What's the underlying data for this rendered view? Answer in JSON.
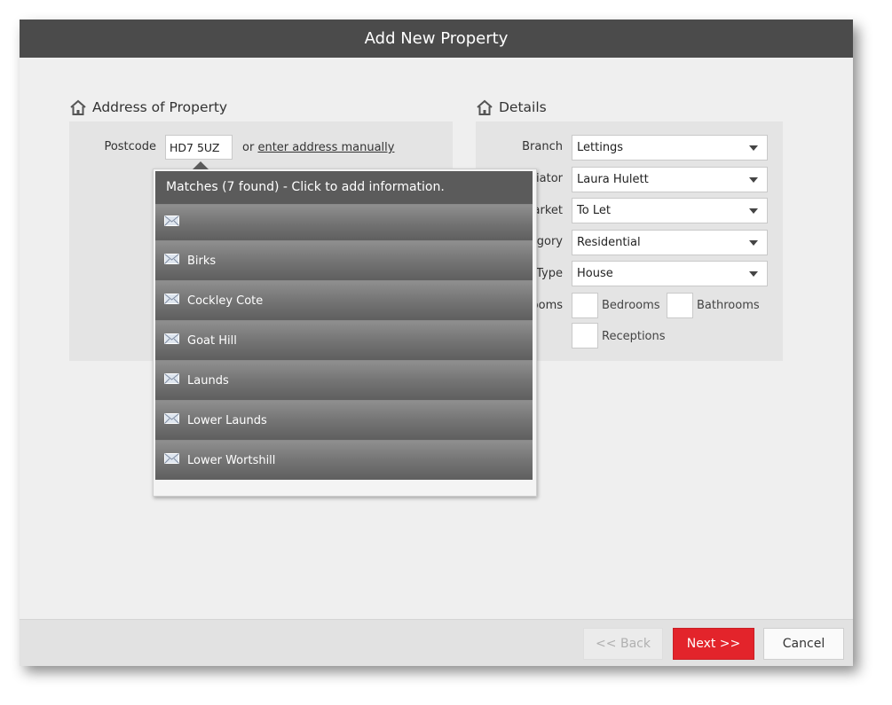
{
  "dialog": {
    "title": "Add New Property"
  },
  "address": {
    "section_title": "Address of Property",
    "postcode_label": "Postcode",
    "postcode_value": "HD7 5UZ",
    "or_text": "or",
    "manual_link": "enter address manually"
  },
  "details": {
    "section_title": "Details",
    "branch_label": "Branch",
    "branch_value": "Lettings",
    "negotiator_label_visible": "tiator",
    "negotiator_value": "Laura Hulett",
    "market_label_visible": "arket",
    "market_value": "To Let",
    "category_label_visible": "egory",
    "category_value": "Residential",
    "type_label_visible": "Type",
    "type_value": "House",
    "rooms_label_visible": "ooms",
    "bedrooms_label": "Bedrooms",
    "bathrooms_label": "Bathrooms",
    "receptions_label": "Receptions"
  },
  "matches": {
    "header": "Matches (7 found) - Click to add information.",
    "items": [
      "",
      "Birks",
      "Cockley Cote",
      "Goat Hill",
      "Launds",
      "Lower Launds",
      "Lower Wortshill"
    ]
  },
  "footer": {
    "back_label": "<< Back",
    "next_label": "Next >>",
    "cancel_label": "Cancel"
  },
  "colors": {
    "titlebar": "#4b4b4b",
    "next_button": "#e3242b",
    "panel": "#e4e4e4"
  },
  "icons": {
    "section": "house-icon",
    "match_item": "envelope-icon",
    "select": "chevron-down-icon"
  }
}
